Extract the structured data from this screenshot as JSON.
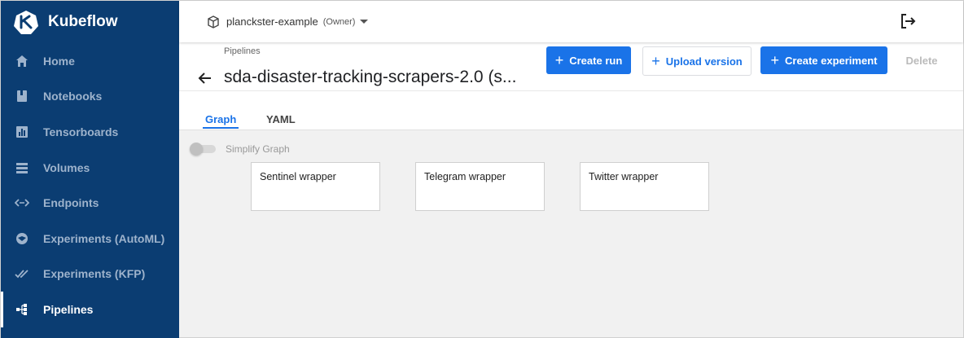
{
  "app": {
    "name": "Kubeflow"
  },
  "sidebar": {
    "items": [
      {
        "label": "Home",
        "icon": "home-icon",
        "active": false
      },
      {
        "label": "Notebooks",
        "icon": "notebook-icon",
        "active": false
      },
      {
        "label": "Tensorboards",
        "icon": "chart-icon",
        "active": false
      },
      {
        "label": "Volumes",
        "icon": "volumes-icon",
        "active": false
      },
      {
        "label": "Endpoints",
        "icon": "endpoints-icon",
        "active": false
      },
      {
        "label": "Experiments (AutoML)",
        "icon": "automl-icon",
        "active": false
      },
      {
        "label": "Experiments (KFP)",
        "icon": "done-all-icon",
        "active": false
      },
      {
        "label": "Pipelines",
        "icon": "pipeline-icon",
        "active": true
      }
    ]
  },
  "topbar": {
    "namespace": "planckster-example",
    "role": "(Owner)"
  },
  "page": {
    "breadcrumb": "Pipelines",
    "title": "sda-disaster-tracking-scrapers-2.0 (s...",
    "buttons": {
      "create_run": "Create run",
      "upload_version": "Upload version",
      "create_experiment": "Create experiment",
      "delete": "Delete"
    },
    "tabs": [
      {
        "label": "Graph",
        "active": true
      },
      {
        "label": "YAML",
        "active": false
      }
    ]
  },
  "graph": {
    "simplify_label": "Simplify Graph",
    "simplify_enabled": false,
    "nodes": [
      "Sentinel wrapper",
      "Telegram wrapper",
      "Twitter wrapper"
    ]
  },
  "colors": {
    "sidebar_bg": "#0b3d72",
    "accent": "#1a73e8",
    "graph_bg": "#f1f1f1"
  }
}
